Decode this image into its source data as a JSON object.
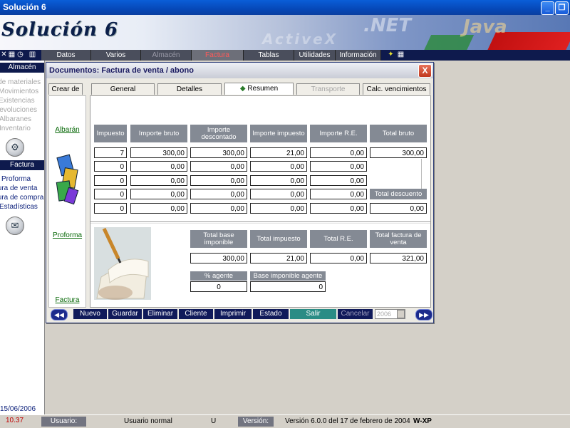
{
  "window": {
    "title": "Solución 6"
  },
  "banner": {
    "logo": "Solución 6",
    "watermark_net": ".NET",
    "watermark_activex": "ActiveX",
    "watermark_java": "Java"
  },
  "menu": {
    "items": [
      {
        "label": "Datos",
        "state": "normal"
      },
      {
        "label": "Varios",
        "state": "normal"
      },
      {
        "label": "Almacén",
        "state": "disabled"
      },
      {
        "label": "Factura",
        "state": "active"
      },
      {
        "label": "Tablas",
        "state": "normal"
      },
      {
        "label": "Utilidades",
        "state": "normal"
      },
      {
        "label": "Información",
        "state": "normal"
      }
    ]
  },
  "left_panel": {
    "almacen_header": "Almacén",
    "almacen_items": [
      "ta de materiales",
      "Movimientos",
      "Existencias",
      "Devoluciones",
      "Albaranes",
      "Inventario"
    ],
    "factura_header": "Factura",
    "factura_items": [
      "Proforma",
      "tura de venta",
      "tura de compra",
      "Estadísticas"
    ],
    "date": "15/06/2006",
    "time": "10.37"
  },
  "dialog": {
    "title": "Documentos: Factura de venta / abono",
    "close_label": "X",
    "tabs": [
      {
        "label": "Crear de",
        "state": "normal"
      },
      {
        "label": "General",
        "state": "normal"
      },
      {
        "label": "Detalles",
        "state": "normal"
      },
      {
        "label": "Resumen",
        "state": "selected"
      },
      {
        "label": "Transporte",
        "state": "disabled"
      },
      {
        "label": "Calc. vencimientos",
        "state": "normal"
      }
    ],
    "nav_links": [
      "Albarán",
      "Proforma",
      "Factura"
    ],
    "headers": [
      "Impuesto",
      "Importe bruto",
      "Importe descontado",
      "Importe impuesto",
      "Importe R.E.",
      "Total bruto"
    ],
    "rows": [
      [
        "7",
        "300,00",
        "300,00",
        "21,00",
        "0,00"
      ],
      [
        "0",
        "0,00",
        "0,00",
        "0,00",
        "0,00"
      ],
      [
        "0",
        "0,00",
        "0,00",
        "0,00",
        "0,00"
      ],
      [
        "0",
        "0,00",
        "0,00",
        "0,00",
        "0,00"
      ],
      [
        "0",
        "0,00",
        "0,00",
        "0,00",
        "0,00"
      ]
    ],
    "total_bruto": "300,00",
    "total_descuento_label": "Total descuento",
    "total_descuento": "0,00",
    "summary_headers": [
      "Total base imponible",
      "Total impuesto",
      "Total R.E.",
      "Total factura de venta"
    ],
    "summary_values": [
      "300,00",
      "21,00",
      "0,00",
      "321,00"
    ],
    "agente_label": "% agente",
    "agente_value": "0",
    "base_agente_label": "Base imponible agente",
    "base_agente_value": "0",
    "buttons": [
      {
        "label": "Nuevo"
      },
      {
        "label": "Guardar"
      },
      {
        "label": "Eliminar"
      },
      {
        "label": "Cliente"
      },
      {
        "label": "Imprimir"
      },
      {
        "label": "Estado"
      },
      {
        "label": "Salir",
        "style": "teal"
      },
      {
        "label": "Cancelar",
        "style": "dim"
      }
    ],
    "year_value": "2006"
  },
  "statusbar": {
    "usuario_label": "Usuario:",
    "usuario_value": "Usuario normal",
    "user_code": "U",
    "version_label": "Versión:",
    "version_value": "Versión 6.0.0 del 17 de febrero de 2004",
    "os": "W-XP"
  },
  "colors": {
    "menubar": "#0e1a4d",
    "header_cell": "#848a94",
    "accent_red": "#ff5a5a",
    "link_green": "#0a6a0a"
  }
}
